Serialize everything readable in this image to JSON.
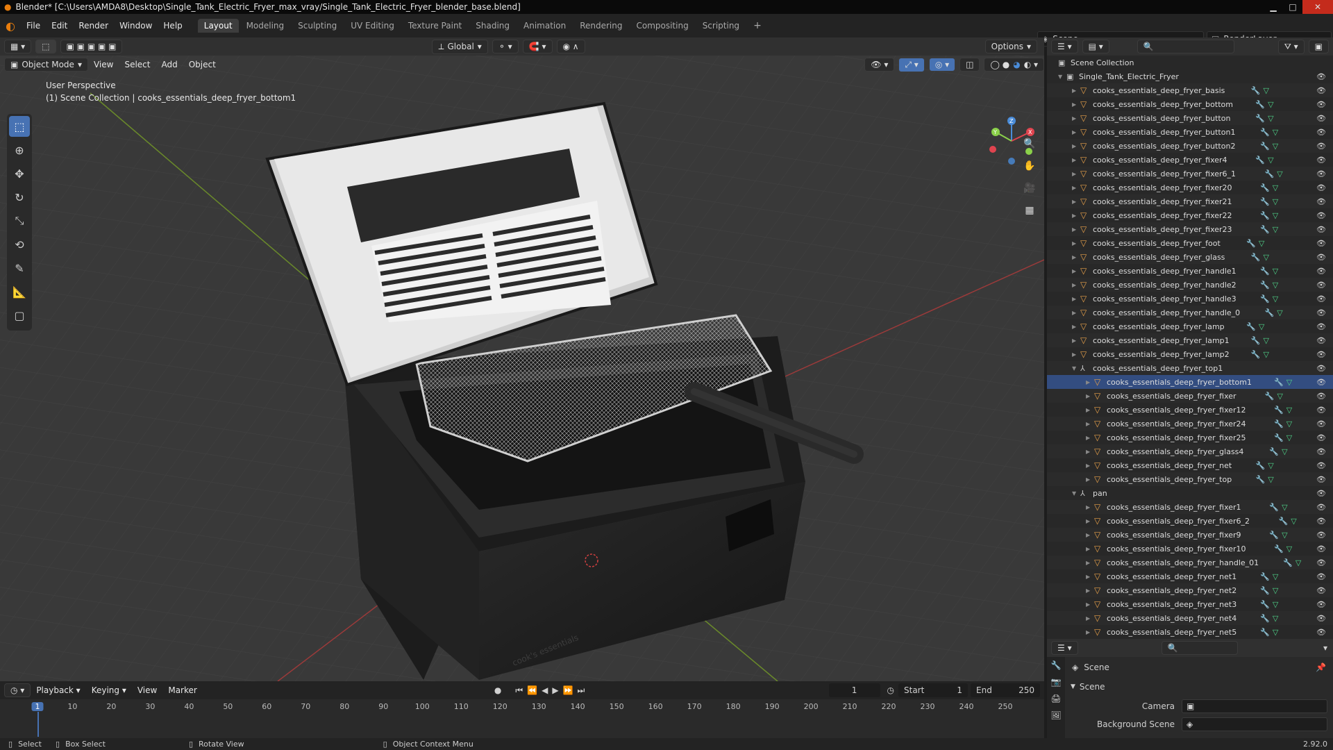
{
  "window": {
    "title": "Blender* [C:\\Users\\AMDA8\\Desktop\\Single_Tank_Electric_Fryer_max_vray/Single_Tank_Electric_Fryer_blender_base.blend]"
  },
  "menu": [
    "File",
    "Edit",
    "Render",
    "Window",
    "Help"
  ],
  "workspaces": [
    {
      "label": "Layout",
      "active": true
    },
    {
      "label": "Modeling"
    },
    {
      "label": "Sculpting"
    },
    {
      "label": "UV Editing"
    },
    {
      "label": "Texture Paint"
    },
    {
      "label": "Shading"
    },
    {
      "label": "Animation"
    },
    {
      "label": "Rendering"
    },
    {
      "label": "Compositing"
    },
    {
      "label": "Scripting"
    }
  ],
  "scene_selector": "Scene",
  "render_layer": "RenderLayer",
  "viewport": {
    "transform_orientation": "Global",
    "options_label": "Options",
    "mode": "Object Mode",
    "menus": [
      "View",
      "Select",
      "Add",
      "Object"
    ],
    "perspective_label": "User Perspective",
    "collection_label": "(1) Scene Collection | cooks_essentials_deep_fryer_bottom1",
    "branding_text": "cook's essentials"
  },
  "outliner": {
    "root": "Scene Collection",
    "items": [
      {
        "label": "Single_Tank_Electric_Fryer",
        "type": "collection",
        "level": 1,
        "expanded": true
      },
      {
        "label": "cooks_essentials_deep_fryer_basis",
        "type": "mesh",
        "level": 2
      },
      {
        "label": "cooks_essentials_deep_fryer_bottom",
        "type": "mesh",
        "level": 2
      },
      {
        "label": "cooks_essentials_deep_fryer_button",
        "type": "mesh",
        "level": 2
      },
      {
        "label": "cooks_essentials_deep_fryer_button1",
        "type": "mesh",
        "level": 2
      },
      {
        "label": "cooks_essentials_deep_fryer_button2",
        "type": "mesh",
        "level": 2
      },
      {
        "label": "cooks_essentials_deep_fryer_fixer4",
        "type": "mesh",
        "level": 2
      },
      {
        "label": "cooks_essentials_deep_fryer_fixer6_1",
        "type": "mesh",
        "level": 2
      },
      {
        "label": "cooks_essentials_deep_fryer_fixer20",
        "type": "mesh",
        "level": 2
      },
      {
        "label": "cooks_essentials_deep_fryer_fixer21",
        "type": "mesh",
        "level": 2
      },
      {
        "label": "cooks_essentials_deep_fryer_fixer22",
        "type": "mesh",
        "level": 2
      },
      {
        "label": "cooks_essentials_deep_fryer_fixer23",
        "type": "mesh",
        "level": 2
      },
      {
        "label": "cooks_essentials_deep_fryer_foot",
        "type": "mesh",
        "level": 2
      },
      {
        "label": "cooks_essentials_deep_fryer_glass",
        "type": "mesh",
        "level": 2
      },
      {
        "label": "cooks_essentials_deep_fryer_handle1",
        "type": "mesh",
        "level": 2
      },
      {
        "label": "cooks_essentials_deep_fryer_handle2",
        "type": "mesh",
        "level": 2
      },
      {
        "label": "cooks_essentials_deep_fryer_handle3",
        "type": "mesh",
        "level": 2
      },
      {
        "label": "cooks_essentials_deep_fryer_handle_0",
        "type": "mesh",
        "level": 2
      },
      {
        "label": "cooks_essentials_deep_fryer_lamp",
        "type": "mesh",
        "level": 2
      },
      {
        "label": "cooks_essentials_deep_fryer_lamp1",
        "type": "mesh",
        "level": 2
      },
      {
        "label": "cooks_essentials_deep_fryer_lamp2",
        "type": "mesh",
        "level": 2
      },
      {
        "label": "cooks_essentials_deep_fryer_top1",
        "type": "empty",
        "level": 2,
        "expanded": true
      },
      {
        "label": "cooks_essentials_deep_fryer_bottom1",
        "type": "mesh",
        "level": 3,
        "selected": true
      },
      {
        "label": "cooks_essentials_deep_fryer_fixer",
        "type": "mesh",
        "level": 3
      },
      {
        "label": "cooks_essentials_deep_fryer_fixer12",
        "type": "mesh",
        "level": 3
      },
      {
        "label": "cooks_essentials_deep_fryer_fixer24",
        "type": "mesh",
        "level": 3
      },
      {
        "label": "cooks_essentials_deep_fryer_fixer25",
        "type": "mesh",
        "level": 3
      },
      {
        "label": "cooks_essentials_deep_fryer_glass4",
        "type": "mesh",
        "level": 3
      },
      {
        "label": "cooks_essentials_deep_fryer_net",
        "type": "mesh",
        "level": 3
      },
      {
        "label": "cooks_essentials_deep_fryer_top",
        "type": "mesh",
        "level": 3
      },
      {
        "label": "pan",
        "type": "empty",
        "level": 2,
        "expanded": true
      },
      {
        "label": "cooks_essentials_deep_fryer_fixer1",
        "type": "mesh",
        "level": 3
      },
      {
        "label": "cooks_essentials_deep_fryer_fixer6_2",
        "type": "mesh",
        "level": 3
      },
      {
        "label": "cooks_essentials_deep_fryer_fixer9",
        "type": "mesh",
        "level": 3
      },
      {
        "label": "cooks_essentials_deep_fryer_fixer10",
        "type": "mesh",
        "level": 3
      },
      {
        "label": "cooks_essentials_deep_fryer_handle_01",
        "type": "mesh",
        "level": 3
      },
      {
        "label": "cooks_essentials_deep_fryer_net1",
        "type": "mesh",
        "level": 3
      },
      {
        "label": "cooks_essentials_deep_fryer_net2",
        "type": "mesh",
        "level": 3
      },
      {
        "label": "cooks_essentials_deep_fryer_net3",
        "type": "mesh",
        "level": 3
      },
      {
        "label": "cooks_essentials_deep_fryer_net4",
        "type": "mesh",
        "level": 3
      },
      {
        "label": "cooks_essentials_deep_fryer_net5",
        "type": "mesh",
        "level": 3
      }
    ]
  },
  "properties": {
    "breadcrumb": "Scene",
    "panel_title": "Scene",
    "camera_label": "Camera",
    "camera_value": "",
    "background_scene_label": "Background Scene",
    "background_scene_value": ""
  },
  "timeline": {
    "menus": [
      "Playback",
      "Keying",
      "View",
      "Marker"
    ],
    "current_frame": "1",
    "start_label": "Start",
    "start_value": "1",
    "end_label": "End",
    "end_value": "250",
    "ticks": [
      "1",
      "10",
      "20",
      "30",
      "40",
      "50",
      "60",
      "70",
      "80",
      "90",
      "100",
      "110",
      "120",
      "130",
      "140",
      "150",
      "160",
      "170",
      "180",
      "190",
      "200",
      "210",
      "220",
      "230",
      "240",
      "250"
    ]
  },
  "statusbar": {
    "select": "Select",
    "box_select": "Box Select",
    "rotate_view": "Rotate View",
    "context_menu": "Object Context Menu",
    "version": "2.92.0"
  },
  "colors": {
    "accent": "#4772b3",
    "mesh_icon": "#e8a14a",
    "axis_x": "#e0444f",
    "axis_y": "#8bd14a",
    "axis_z": "#4a8cd9"
  }
}
